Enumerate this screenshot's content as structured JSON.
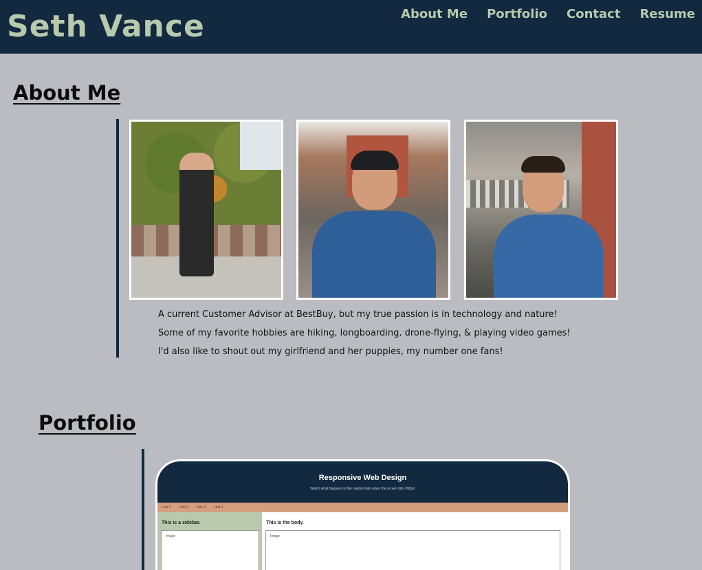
{
  "header": {
    "brand": "Seth Vance",
    "nav": [
      "About Me",
      "Portfolio",
      "Contact",
      "Resume"
    ]
  },
  "about": {
    "title": "About Me",
    "photos": [
      "photo-standing-by-bench",
      "photo-smiling-with-cap",
      "photo-smiling-porch"
    ],
    "paragraphs": [
      "A current Customer Advisor at BestBuy, but my true passion is in technology and nature!",
      "Some of my favorite hobbies are hiking, longboarding, drone-flying, & playing video games!",
      "I'd also like to shout out my girlfriend and her puppies, my number one fans!"
    ]
  },
  "portfolio": {
    "title": "Portfolio",
    "preview": {
      "hero_title": "Responsive Web Design",
      "hero_subtitle": "Watch what happens to the navbar links when the screen hits 768px!",
      "nav_links": [
        "Link 1",
        "Link 2",
        "Link 3",
        "Link 4"
      ],
      "sidebar_heading": "This is a sidebar.",
      "sidebar_image_label": "Image",
      "body_heading": "This is the body.",
      "body_image_label": "Image"
    }
  },
  "colors": {
    "header_bg": "#12293f",
    "brand_text": "#b9c9ad",
    "page_bg": "#bbbcc1",
    "accent_nav": "#d59e7e"
  }
}
